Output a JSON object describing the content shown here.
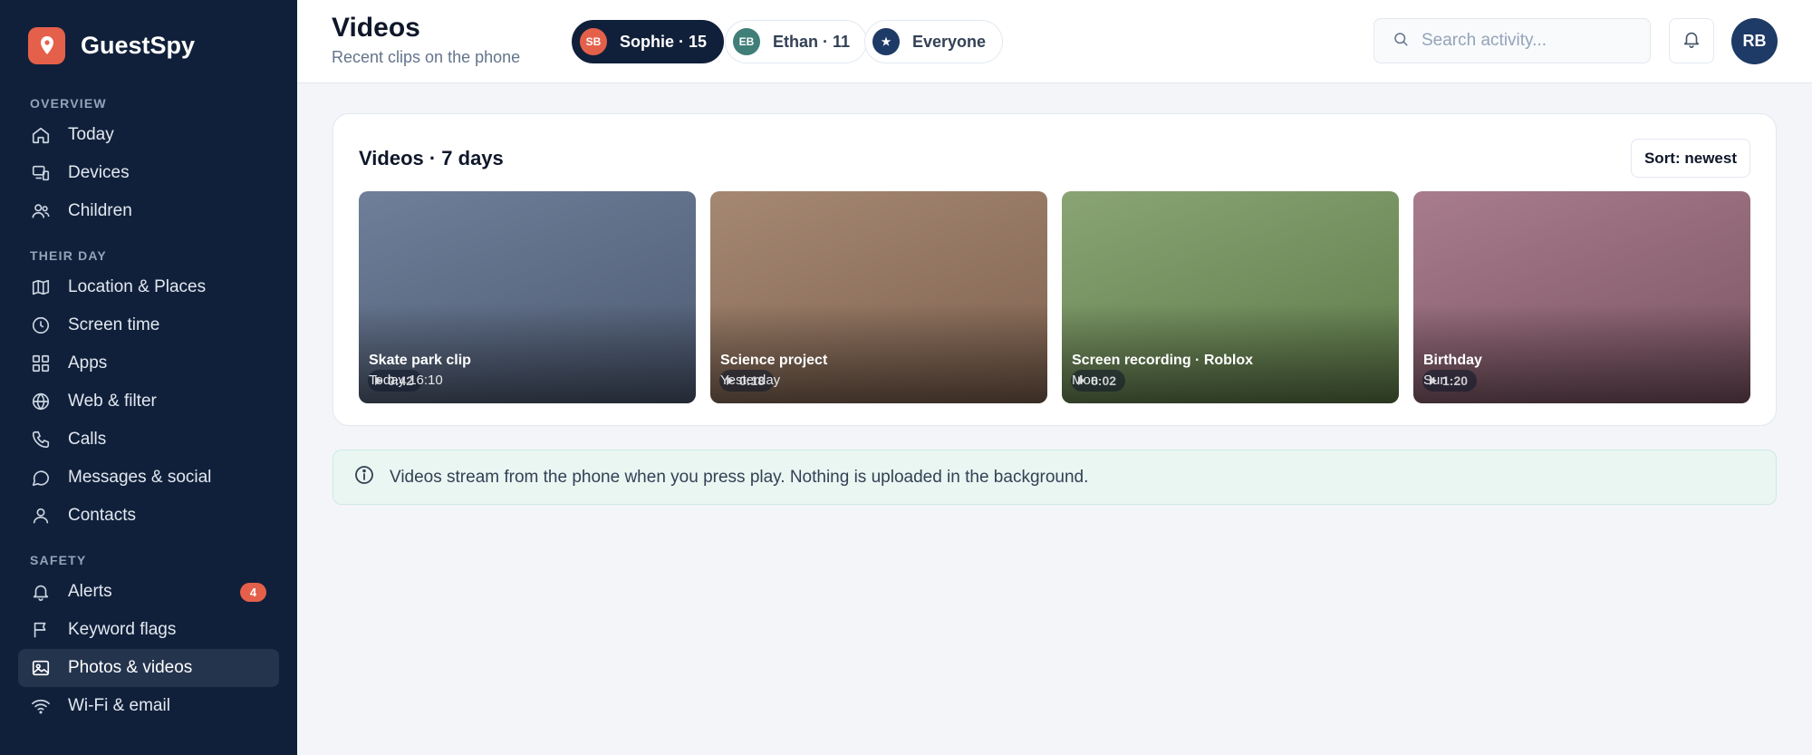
{
  "app": {
    "name": "GuestSpy"
  },
  "sidebar": {
    "sections": [
      {
        "label": "OVERVIEW",
        "items": [
          {
            "label": "Today",
            "icon": "home-icon"
          },
          {
            "label": "Devices",
            "icon": "devices-icon"
          },
          {
            "label": "Children",
            "icon": "users-icon"
          }
        ]
      },
      {
        "label": "THEIR DAY",
        "items": [
          {
            "label": "Location & Places",
            "icon": "map-icon"
          },
          {
            "label": "Screen time",
            "icon": "clock-icon"
          },
          {
            "label": "Apps",
            "icon": "apps-grid-icon"
          },
          {
            "label": "Web & filter",
            "icon": "globe-icon"
          },
          {
            "label": "Calls",
            "icon": "phone-icon"
          },
          {
            "label": "Messages & social",
            "icon": "message-icon"
          },
          {
            "label": "Contacts",
            "icon": "user-icon"
          }
        ]
      },
      {
        "label": "SAFETY",
        "items": [
          {
            "label": "Alerts",
            "icon": "bell-icon",
            "badge": "4"
          },
          {
            "label": "Keyword flags",
            "icon": "flag-icon"
          },
          {
            "label": "Photos & videos",
            "icon": "image-icon",
            "active": true
          },
          {
            "label": "Wi-Fi & email",
            "icon": "wifi-icon"
          }
        ]
      }
    ]
  },
  "header": {
    "title": "Videos",
    "subtitle": "Recent clips on the phone",
    "chips": [
      {
        "initials": "SB",
        "label": "Sophie · 15",
        "active": true,
        "color": "#e5604a"
      },
      {
        "initials": "EB",
        "label": "Ethan · 11",
        "active": false,
        "color": "#3f7f78"
      },
      {
        "initials": "★",
        "label": "Everyone",
        "active": false,
        "color": "#1e3a66"
      }
    ],
    "search_placeholder": "Search activity...",
    "user_initials": "RB"
  },
  "videos_card": {
    "title": "Videos · 7 days",
    "sort_label": "Sort: newest",
    "videos": [
      {
        "title": "Skate park clip",
        "time": "Today 16:10",
        "duration": "0:42",
        "color_top": "#6f7f99",
        "color_bottom": "#4d5a72"
      },
      {
        "title": "Science project",
        "time": "Yesterday",
        "duration": "0:18",
        "color_top": "#a58872",
        "color_bottom": "#7f6250"
      },
      {
        "title": "Screen recording · Roblox",
        "time": "Mon",
        "duration": "6:02",
        "color_top": "#8aa474",
        "color_bottom": "#5e7a49"
      },
      {
        "title": "Birthday",
        "time": "Sun",
        "duration": "1:20",
        "color_top": "#a87c8c",
        "color_bottom": "#7b5464"
      }
    ]
  },
  "info_banner": {
    "text": "Videos stream from the phone when you press play. Nothing is uploaded in the background."
  }
}
